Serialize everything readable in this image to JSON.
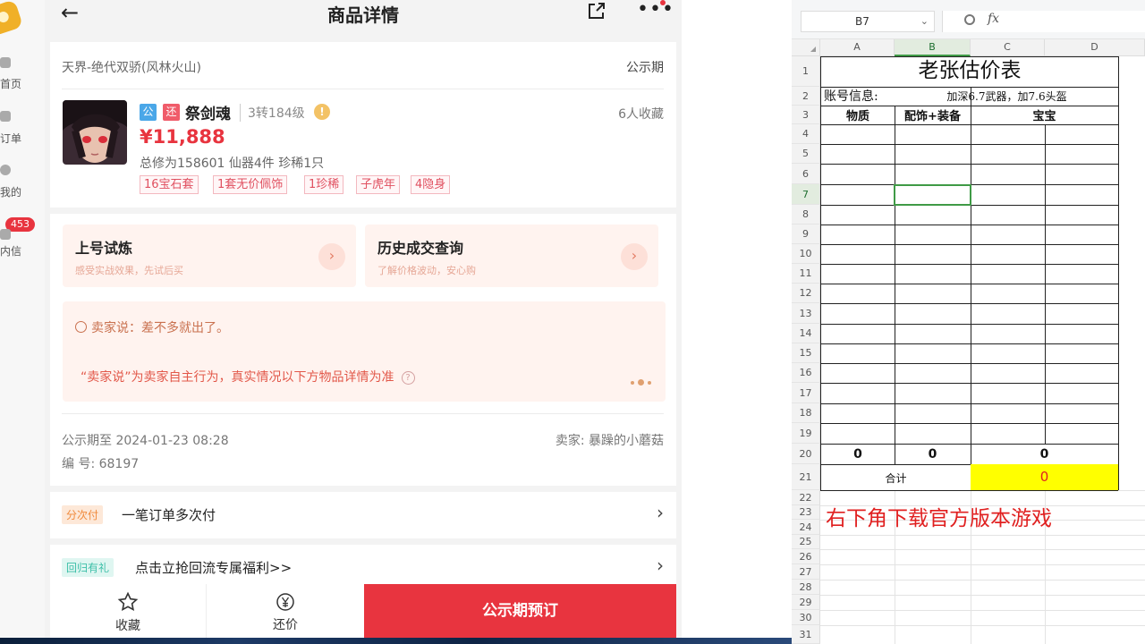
{
  "left_nav": {
    "items": [
      {
        "label": "首页",
        "icon": "home-icon"
      },
      {
        "label": "订单",
        "icon": "order-icon"
      },
      {
        "label": "我的",
        "icon": "user-icon"
      },
      {
        "label": "内信",
        "icon": "message-icon"
      }
    ],
    "message_badge": "453"
  },
  "header": {
    "title": "商品详情",
    "icons": [
      "back-arrow-icon",
      "share-icon",
      "more-icon"
    ]
  },
  "item": {
    "server": "天界-绝代双骄(风林火山)",
    "status": "公示期",
    "tag_public": "公",
    "tag_return": "还",
    "role_name": "祭剑魂",
    "level": "3转184级",
    "favorites": "6人收藏",
    "price": "¥11,888",
    "stats": "总修为158601  仙器4件  珍稀1只",
    "chips": [
      "16宝石套",
      "1套无价佩饰",
      "1珍稀",
      "子虎年",
      "4隐身"
    ]
  },
  "tiles": [
    {
      "title": "上号试炼",
      "subtitle": "感受实战效果，先试后买"
    },
    {
      "title": "历史成交查询",
      "subtitle": "了解价格波动，安心购"
    }
  ],
  "seller_box": {
    "says": "卖家说：差不多就出了。",
    "note": "“卖家说”为卖家自主行为，真实情况以下方物品详情为准"
  },
  "meta": {
    "public_until": "公示期至 2024-01-23 08:28",
    "seller": "卖家: 暴躁的小蘑菇",
    "serial": "编 号: 68197"
  },
  "rows": [
    {
      "badge": "分次付",
      "text": "一笔订单多次付",
      "badge_color": "#f08a3c",
      "badge_bg": "#fde8d8"
    },
    {
      "badge": "回归有礼",
      "text": "点击立抢回流专属福利>>",
      "badge_color": "#3cbfa8",
      "badge_bg": "#dff6f1"
    }
  ],
  "bottom_bar": {
    "favorite": "收藏",
    "bargain": "还价",
    "buy": "公示期预订"
  },
  "spreadsheet": {
    "name_box": "B7",
    "fx_label": "fx",
    "columns": [
      "A",
      "B",
      "C",
      "D"
    ],
    "rows": [
      "1",
      "2",
      "3",
      "4",
      "5",
      "6",
      "7",
      "8",
      "9",
      "10",
      "11",
      "12",
      "13",
      "14",
      "15",
      "16",
      "17",
      "18",
      "19",
      "20",
      "21",
      "22",
      "23",
      "24",
      "25",
      "26",
      "27",
      "28",
      "29",
      "30",
      "31"
    ],
    "title": "老张估价表",
    "account_label": "账号信息:",
    "account_value": "加深6.7武器，加7.6头盔",
    "headers": [
      "物质",
      "配饰+装备",
      "宝宝"
    ],
    "row20": [
      "0",
      "0",
      "0"
    ],
    "total_label": "合计",
    "total_value": "0",
    "promo": "右下角下载官方版本游戏"
  }
}
